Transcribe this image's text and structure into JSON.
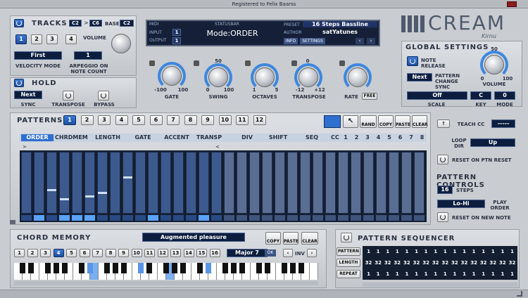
{
  "registered": "Registered to Felix Baarss",
  "tracks": {
    "title": "TRACKS",
    "range_from": "C2",
    "range_sep": ">",
    "range_to": "C6",
    "base_label": "BASE",
    "base_value": "C2",
    "numbers": [
      "1",
      "2",
      "3",
      "4"
    ],
    "volume_label": "VOLUME",
    "velocity_value": "First",
    "velocity_label": "VELOCITY MODE",
    "arp_value": "1",
    "arp_label": "ARPEGGIO ON NOTE COUNT"
  },
  "hold": {
    "title": "HOLD",
    "sync_value": "Next",
    "sync_label": "SYNC",
    "transpose_label": "TRANSPOSE",
    "bypass_label": "BYPASS"
  },
  "display": {
    "midi_label": "MIDI",
    "status_label": "STATUSBAR",
    "input_label": "INPUT",
    "input_value": "1",
    "output_label": "OUTPUT",
    "output_value": "1",
    "mode": "Mode:ORDER",
    "preset_label": "PRESET",
    "preset_value": "16 Steps Bassline",
    "author_label": "AUTHOR",
    "author_value": "satYatunes",
    "info": "INFO",
    "settings": "SETTINGS",
    "arrow_left": "‹",
    "arrow_right": "›"
  },
  "knobs": {
    "gate": {
      "label": "GATE",
      "min": "-100",
      "max": "100"
    },
    "swing": {
      "label": "SWING",
      "min": "0",
      "mid": "50",
      "max": "100"
    },
    "octaves": {
      "label": "OCTAVES",
      "min": "1",
      "max": "5"
    },
    "transpose": {
      "label": "TRANSPOSE",
      "min": "-12",
      "mid": "0",
      "max": "+12"
    },
    "rate": {
      "label": "RATE",
      "free": "FREE"
    }
  },
  "logo": {
    "name": "CREAM",
    "brand": "Kirnu"
  },
  "global": {
    "title": "GLOBAL SETTINGS",
    "note_release": "NOTE RELEASE",
    "next": "Next",
    "pattern_change_sync": "PATTERN CHANGE SYNC",
    "vol_top": "50",
    "vol_min": "0",
    "vol_max": "100",
    "volume_label": "VOLUME",
    "scale_value": "Off",
    "key_value": "C",
    "mode_value": "0",
    "scale_label": "SCALE",
    "key_label": "KEY",
    "mode_label": "MODE"
  },
  "patterns": {
    "title": "PATTERNS",
    "numbers": [
      "1",
      "2",
      "3",
      "4",
      "5",
      "6",
      "7",
      "8",
      "9",
      "10",
      "11",
      "12"
    ],
    "tools": {
      "rand": "RAND",
      "copy": "COPY",
      "paste": "PASTE",
      "clear": "CLEAR"
    },
    "tabs": [
      "ORDER",
      "CHRDMEM",
      "LENGTH",
      "GATE",
      "ACCENT",
      "TRANSP",
      "DIV",
      "SHIFT",
      "SEQ"
    ],
    "cc_label": "CC",
    "cc_numbers": [
      "1",
      "2",
      "3",
      "4",
      "5",
      "6",
      "7",
      "8"
    ],
    "start_mark": ">",
    "end_mark": "<"
  },
  "right": {
    "teach_cc": "TEACH CC",
    "teach_value": "-----",
    "loop_dir_label": "LOOP DIR",
    "loop_dir_value": "Up",
    "reset_ptn": "RESET ON PTN RESET",
    "controls_title": "PATTERN CONTROLS",
    "steps_value": "16",
    "steps_label": "STEPS",
    "play_order_value": "Lo-Hi",
    "play_order_label": "PLAY ORDER",
    "reset_new_note": "RESET ON NEW NOTE"
  },
  "chord": {
    "title": "CHORD MEMORY",
    "name": "Augmented pleasure",
    "numbers": [
      "1",
      "2",
      "3",
      "4",
      "5",
      "6",
      "7",
      "8",
      "9",
      "10",
      "11",
      "12",
      "13",
      "14",
      "15",
      "16"
    ],
    "chord_type": "Major 7",
    "ok": "OK",
    "inv": "INV",
    "copy": "COPY",
    "paste": "PASTE",
    "clear": "CLEAR"
  },
  "sequencer": {
    "title": "PATTERN SEQUENCER",
    "rows": [
      {
        "label": "PATTERN",
        "values": [
          "1",
          "1",
          "1",
          "1",
          "1",
          "1",
          "1",
          "1",
          "1",
          "1",
          "1",
          "1",
          "1",
          "1",
          "1",
          "1"
        ]
      },
      {
        "label": "LENGTH",
        "values": [
          "32",
          "32",
          "32",
          "32",
          "32",
          "32",
          "32",
          "32",
          "32",
          "32",
          "32",
          "32",
          "32",
          "32",
          "32",
          "32"
        ]
      },
      {
        "label": "REPEAT",
        "values": [
          "1",
          "1",
          "1",
          "1",
          "1",
          "1",
          "1",
          "1",
          "1",
          "1",
          "1",
          "1",
          "1",
          "1",
          "1",
          "1"
        ]
      }
    ]
  },
  "colors": {
    "accent": "#2f6fd0",
    "panel": "#c9ccd0",
    "dark": "#152038"
  }
}
